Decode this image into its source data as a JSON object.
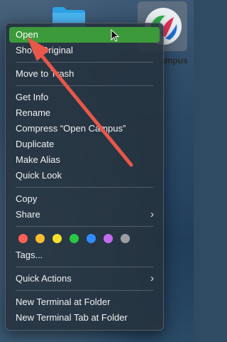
{
  "desktop": {
    "app_label": "ampus",
    "accent_color": "#3d9a3a",
    "folder_icon": "folder-icon",
    "app_icon": "open-campus-app-icon"
  },
  "context_menu": {
    "items": [
      {
        "label": "Open"
      },
      {
        "label": "Show Original"
      },
      {
        "label": "Move to Trash"
      },
      {
        "label": "Get Info"
      },
      {
        "label": "Rename"
      },
      {
        "label": "Compress “Open Campus”"
      },
      {
        "label": "Duplicate"
      },
      {
        "label": "Make Alias"
      },
      {
        "label": "Quick Look"
      },
      {
        "label": "Copy"
      },
      {
        "label": "Share"
      },
      {
        "label": "Tags..."
      },
      {
        "label": "Quick Actions"
      },
      {
        "label": "New Terminal at Folder"
      },
      {
        "label": "New Terminal Tab at Folder"
      }
    ],
    "tag_colors": [
      "#ff5f57",
      "#febc2e",
      "#f5e02a",
      "#28c840",
      "#2f8cff",
      "#c36cf0",
      "#9a9ea3"
    ]
  },
  "annotation": {
    "arrow_color": "#e8574a"
  }
}
